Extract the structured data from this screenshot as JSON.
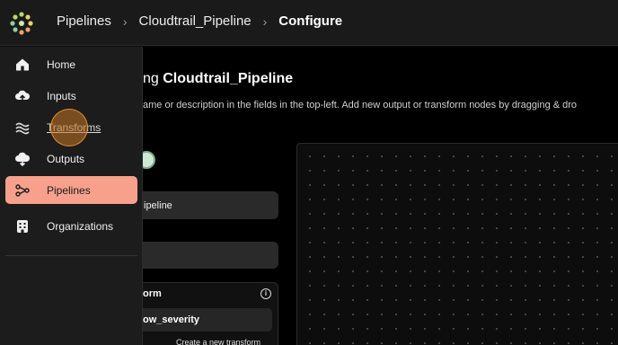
{
  "header": {
    "breadcrumbs": [
      "Pipelines",
      "Cloudtrail_Pipeline",
      "Configure"
    ],
    "separator": "›"
  },
  "page": {
    "title_prefix": "ng ",
    "title_name": "Cloudtrail_Pipeline",
    "description": "ame or description in the fields in the top-left. Add new output or transform nodes by dragging & dro"
  },
  "form": {
    "name_value": "ipeline",
    "description_value": "",
    "transform_card": {
      "title": "orm",
      "selected": "ow_severity",
      "create_link": "Create a new transform"
    }
  },
  "sidebar": {
    "items": [
      {
        "label": "Home",
        "icon": "home-icon"
      },
      {
        "label": "Inputs",
        "icon": "cloud-upload-icon"
      },
      {
        "label": "Transforms",
        "icon": "waves-icon"
      },
      {
        "label": "Outputs",
        "icon": "cloud-download-icon"
      },
      {
        "label": "Pipelines",
        "icon": "pipeline-icon"
      },
      {
        "label": "Organizations",
        "icon": "building-icon"
      }
    ],
    "active": "Pipelines",
    "hovered": "Transforms"
  },
  "colors": {
    "accent": "#f7a18d",
    "sidebar_bg": "#1c1c1c",
    "cursor_halo": "#c47824"
  }
}
